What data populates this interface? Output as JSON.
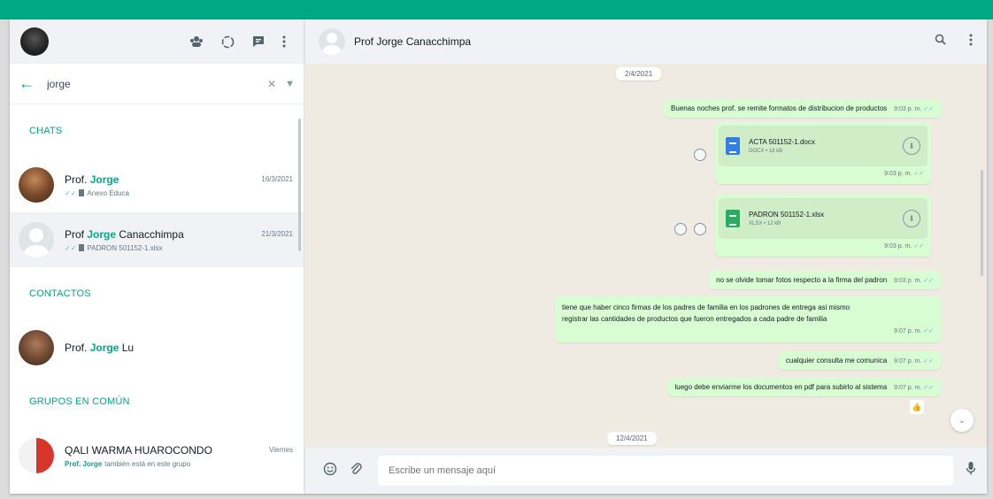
{
  "sidebar": {
    "search": {
      "value": "jorge",
      "placeholder": ""
    },
    "sections": {
      "chats": "CHATS",
      "contacts": "CONTACTOS",
      "groups": "GRUPOS EN COMÚN"
    },
    "chats": [
      {
        "name_prefix": "Prof. ",
        "name_match": "Jorge",
        "name_suffix": "",
        "time": "16/3/2021",
        "subtitle": "Anexo Educa"
      },
      {
        "name_prefix": "Prof ",
        "name_match": "Jorge",
        "name_suffix": " Canacchimpa",
        "time": "21/3/2021",
        "subtitle": "PADRON 501152-1.xlsx"
      }
    ],
    "contacts": [
      {
        "name_prefix": "Prof. ",
        "name_match": "Jorge",
        "name_suffix": " Lu"
      }
    ],
    "groups": [
      {
        "name": "QALI WARMA HUAROCONDO",
        "time": "Viernes",
        "sub_match": "Prof. Jorge",
        "sub_rest": " también está en este grupo"
      }
    ]
  },
  "conversation": {
    "contact_name": "Prof Jorge Canacchimpa",
    "date_pills": [
      "2/4/2021",
      "12/4/2021"
    ],
    "messages": [
      {
        "text": "Buenas noches prof. se remite formatos de distribucion de productos",
        "time": "9:03 p. m."
      },
      {
        "doc_name": "ACTA 501152-1.docx",
        "doc_meta": "DOCX • 18 kB",
        "time": "9:03 p. m."
      },
      {
        "doc_name": "PADRON 501152-1.xlsx",
        "doc_meta": "XLSX • 12 kB",
        "time": "9:03 p. m."
      },
      {
        "text": "no se olvide tomar fotos respecto a la firma del padron",
        "time": "9:03 p. m."
      },
      {
        "line1": "tiene que haber cinco firmas de los padres de familia en los padrones de entrega  asi mismo",
        "line2": "registrar las cantidades de productos que fueron entregados a cada padre de familia",
        "time": "9:07 p. m."
      },
      {
        "text": "cualquier consulta me comunica",
        "time": "9:07 p. m."
      },
      {
        "text": "luego debe enviarme los documentos en pdf para subirlo al sistema",
        "time": "9:07 p. m."
      }
    ],
    "reaction": "👍"
  },
  "composer": {
    "placeholder": "Escribe un mensaje aquí"
  },
  "colors": {
    "brand": "#00a884",
    "outgoing_bubble": "#d9fdd3",
    "chat_bg": "#efeae2",
    "header_bg": "#f0f2f5"
  }
}
